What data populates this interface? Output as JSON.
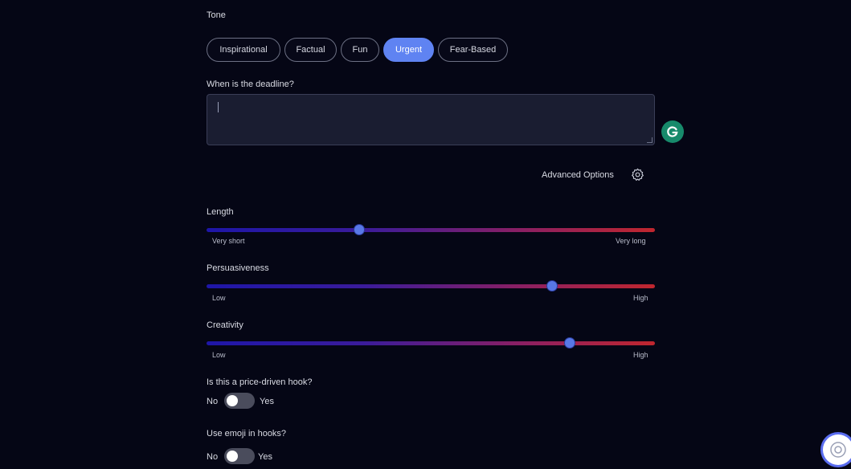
{
  "tone": {
    "label": "Tone",
    "options": [
      "Inspirational",
      "Factual",
      "Fun",
      "Urgent",
      "Fear-Based"
    ],
    "selected": "Urgent"
  },
  "deadline": {
    "label": "When is the deadline?",
    "value": ""
  },
  "advanced": {
    "label": "Advanced Options",
    "icon": "gear-icon"
  },
  "sliders": {
    "length": {
      "label": "Length",
      "min_label": "Very short",
      "max_label": "Very long",
      "value": 0.34
    },
    "persuasiveness": {
      "label": "Persuasiveness",
      "min_label": "Low",
      "max_label": "High",
      "value": 0.77
    },
    "creativity": {
      "label": "Creativity",
      "min_label": "Low",
      "max_label": "High",
      "value": 0.81
    }
  },
  "price_hook": {
    "label": "Is this a price-driven hook?",
    "no": "No",
    "yes": "Yes",
    "value": false
  },
  "emoji": {
    "label": "Use emoji in hooks?",
    "no": "No",
    "yes": "Yes",
    "value": false
  },
  "colors": {
    "accent": "#5f83f2",
    "background": "#050615",
    "grammarly": "#178a6b"
  }
}
